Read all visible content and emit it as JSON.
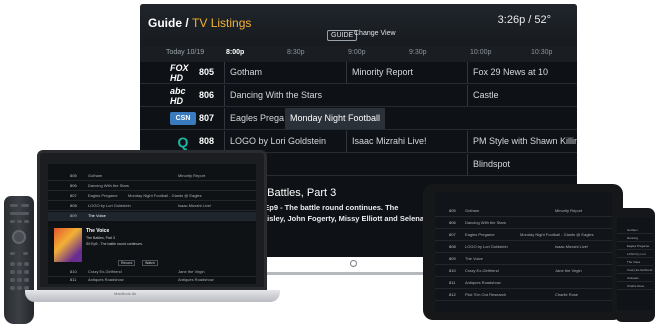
{
  "tv": {
    "breadcrumb_main": "Guide",
    "breadcrumb_sep": " / ",
    "breadcrumb_sub": "TV Listings",
    "guide_button": "GUIDE",
    "change_view": "Change View",
    "clock_weather": "3:26p / 52°",
    "times": {
      "today": "Today 10/19",
      "slots": [
        "8:00p",
        "8:30p",
        "9:00p",
        "9:30p",
        "10:00p",
        "10:30p"
      ]
    },
    "rows": [
      {
        "logo": "FOX HD",
        "number": "805",
        "programs": [
          "Gotham",
          "Minority Report",
          "Fox 29 News at 10"
        ]
      },
      {
        "logo": "abc HD",
        "number": "806",
        "programs": [
          "Dancing With the Stars",
          "Castle"
        ]
      },
      {
        "logo": "CSN",
        "number": "807",
        "programs": [
          "Eagles Prega",
          "Monday Night Football"
        ]
      },
      {
        "logo": "Q",
        "number": "808",
        "programs": [
          "LOGO by Lori Goldstein",
          "Isaac Mizrahi Live!",
          "PM Style with Shawn Killinge"
        ]
      },
      {
        "logo": "",
        "number": "",
        "programs": [
          "Blindspot"
        ]
      }
    ],
    "detail": {
      "title": "e Battles, Part 3",
      "line1": "9 Ep9 - The battle round continues. The",
      "line2": "Paisley, John Fogerty, Missy Elliott and Selena"
    }
  },
  "laptop": {
    "brand": "MacBook Air",
    "rows": [
      {
        "number": "805",
        "programs": [
          "Gotham",
          "Minority Report"
        ]
      },
      {
        "number": "806",
        "programs": [
          "Dancing With the Stars",
          ""
        ]
      },
      {
        "number": "807",
        "programs": [
          "Eagles Pregame",
          "Monday Night Football - Giants @ Eagles"
        ]
      },
      {
        "number": "808",
        "programs": [
          "LOGO by Lori Goldstein",
          "Isaac Mizrahi Live!"
        ]
      },
      {
        "number": "809",
        "programs": [
          "The Voice",
          ""
        ]
      }
    ],
    "detail": {
      "title": "The Voice",
      "line1": "The Battles, Part 3",
      "line2": "S9 Ep9 - The battle round continues.",
      "record": "Record",
      "watch": "Watch"
    },
    "rows_bottom": [
      {
        "number": "810",
        "programs": [
          "Crazy Ex-Girlfriend",
          "Jane the Virgin"
        ]
      },
      {
        "number": "811",
        "programs": [
          "Antiques Roadshow",
          "Antiques Roadshow"
        ]
      }
    ]
  },
  "tablet": {
    "rows": [
      {
        "number": "805",
        "programs": [
          "Gotham",
          "Minority Report"
        ]
      },
      {
        "number": "806",
        "programs": [
          "Dancing With the Stars",
          ""
        ]
      },
      {
        "number": "807",
        "programs": [
          "Eagles Pregame",
          "Monday Night Football - Giants @ Eagles"
        ]
      },
      {
        "number": "808",
        "programs": [
          "LOGO by Lori Goldstein",
          "Isaac Mizrahi Live!"
        ]
      },
      {
        "number": "809",
        "programs": [
          "The Voice",
          ""
        ]
      },
      {
        "number": "810",
        "programs": [
          "Crazy Ex-Girlfriend",
          "Jane the Virgin"
        ]
      },
      {
        "number": "811",
        "programs": [
          "Antiques Roadshow",
          ""
        ]
      },
      {
        "number": "812",
        "programs": [
          "Pick 'Em Out Research",
          "Charlie Rose"
        ]
      }
    ]
  },
  "phone": {
    "rows": [
      "Gotham",
      "Dancing",
      "Eagles Pregame",
      "LOGO by Lori",
      "The Voice",
      "Crazy Ex-Girlfriend",
      "Antiques",
      "Charlie Rose"
    ]
  }
}
